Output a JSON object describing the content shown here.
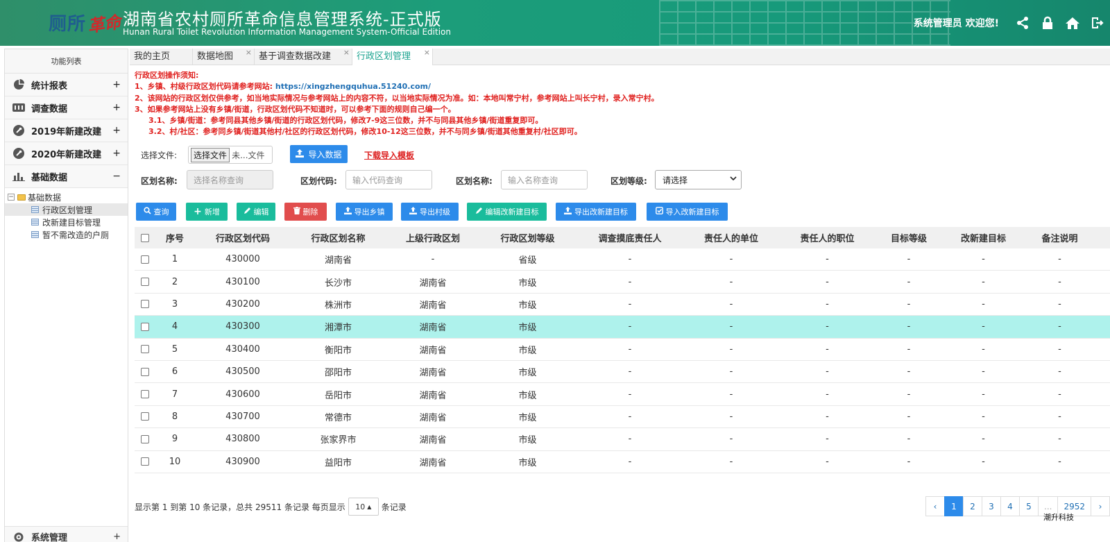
{
  "header": {
    "logo_part1": "厕所",
    "logo_part2": "革命",
    "title": "湖南省农村厕所革命信息管理系统-正式版",
    "subtitle": "Hunan Rural Toilet Revolution Information Management System-Official Edition",
    "welcome": "系统管理员 欢迎您!"
  },
  "sidebar": {
    "title": "功能列表",
    "items": [
      {
        "label": "统计报表",
        "toggle": "+"
      },
      {
        "label": "调查数据",
        "toggle": "+"
      },
      {
        "label": "2019年新建改建",
        "toggle": "+"
      },
      {
        "label": "2020年新建改建",
        "toggle": "+"
      },
      {
        "label": "基础数据",
        "toggle": "−"
      }
    ],
    "tree_root": "基础数据",
    "tree_toggle": "−",
    "tree_children": [
      "行政区划管理",
      "改新建目标管理",
      "暂不需改造的户厕"
    ],
    "bottom_item": "系统管理",
    "bottom_toggle": "+"
  },
  "tabs": [
    {
      "label": "我的主页"
    },
    {
      "label": "数据地图"
    },
    {
      "label": "基于调查数据改建"
    },
    {
      "label": "行政区划管理"
    }
  ],
  "notice": {
    "title": "行政区划操作须知:",
    "line1_prefix": "1、乡镇、村级行政区划代码请参考网站: ",
    "line1_link": "https://xingzhengquhua.51240.com/",
    "line2": "2、该网站的行政区划仅供参考，如当地实际情况与参考网站上的内容不符，以当地实际情况为准。如：本地叫常宁村，参考网站上叫长宁村，录入常宁村。",
    "line3": "3、如果参考网站上没有乡镇/街道，行政区划代码不知道时，可以参考下面的规则自己编一个。",
    "line4": "3.1、乡镇/街道：参考同县其他乡镇/街道的行政区划代码，修改7-9这三位数，并不与同县其他乡镇/街道重复即可。",
    "line5": "3.2、村/社区：参考同乡镇/街道其他村/社区的行政区划代码，修改10-12这三位数，并不与同乡镇/街道其他重复村/社区即可。"
  },
  "file": {
    "label": "选择文件:",
    "button": "选择文件",
    "filename": "未...文件",
    "import": "导入数据",
    "template": "下载导入模板"
  },
  "search": {
    "name_label": "区划名称:",
    "name_placeholder": "选择名称查询",
    "code_label": "区划代码:",
    "code_placeholder": "输入代码查询",
    "name2_label": "区划名称:",
    "name2_placeholder": "输入名称查询",
    "level_label": "区划等级:",
    "level_value": "请选择"
  },
  "toolbar": {
    "query": "查询",
    "add": "新增",
    "edit": "编辑",
    "delete": "删除",
    "export_town": "导出乡镇",
    "export_village": "导出村级",
    "edit_target": "编辑改新建目标",
    "export_target": "导出改新建目标",
    "import_target": "导入改新建目标"
  },
  "table": {
    "headers": [
      "序号",
      "行政区划代码",
      "行政区划名称",
      "上级行政区划",
      "行政区划等级",
      "调查摸底责任人",
      "责任人的单位",
      "责任人的职位",
      "目标等级",
      "改新建目标",
      "备注说明"
    ],
    "rows": [
      [
        "1",
        "430000",
        "湖南省",
        "-",
        "省级",
        "-",
        "-",
        "-",
        "-",
        "-",
        "-"
      ],
      [
        "2",
        "430100",
        "长沙市",
        "湖南省",
        "市级",
        "-",
        "-",
        "-",
        "-",
        "-",
        "-"
      ],
      [
        "3",
        "430200",
        "株洲市",
        "湖南省",
        "市级",
        "-",
        "-",
        "-",
        "-",
        "-",
        "-"
      ],
      [
        "4",
        "430300",
        "湘潭市",
        "湖南省",
        "市级",
        "-",
        "-",
        "-",
        "-",
        "-",
        "-"
      ],
      [
        "5",
        "430400",
        "衡阳市",
        "湖南省",
        "市级",
        "-",
        "-",
        "-",
        "-",
        "-",
        "-"
      ],
      [
        "6",
        "430500",
        "邵阳市",
        "湖南省",
        "市级",
        "-",
        "-",
        "-",
        "-",
        "-",
        "-"
      ],
      [
        "7",
        "430600",
        "岳阳市",
        "湖南省",
        "市级",
        "-",
        "-",
        "-",
        "-",
        "-",
        "-"
      ],
      [
        "8",
        "430700",
        "常德市",
        "湖南省",
        "市级",
        "-",
        "-",
        "-",
        "-",
        "-",
        "-"
      ],
      [
        "9",
        "430800",
        "张家界市",
        "湖南省",
        "市级",
        "-",
        "-",
        "-",
        "-",
        "-",
        "-"
      ],
      [
        "10",
        "430900",
        "益阳市",
        "湖南省",
        "市级",
        "-",
        "-",
        "-",
        "-",
        "-",
        "-"
      ]
    ]
  },
  "footer": {
    "text_before": "显示第 1 到第 10 条记录，总共 29511 条记录 每页显示",
    "page_size": "10",
    "text_after": "条记录"
  },
  "pager": {
    "prev": "‹",
    "pages": [
      "1",
      "2",
      "3",
      "4",
      "5",
      "...",
      "2952"
    ],
    "next": "›"
  },
  "brand": "潮升科技"
}
